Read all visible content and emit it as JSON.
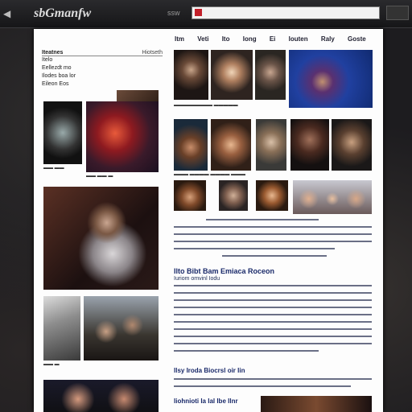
{
  "browser": {
    "logo": "sbGmanfw",
    "menu_label": "ssw"
  },
  "nav": {
    "items": [
      "Itm",
      "Veti",
      "Ito",
      "Iong",
      "Ei",
      "Iouten",
      "Raly",
      "Goste"
    ]
  },
  "sidebar": {
    "header": "Iteatnes",
    "header_right": "Hiotseth",
    "items": [
      "Itelo",
      "Eellezdt mo",
      "Ilodes boa lor",
      "Eileon Eos"
    ]
  },
  "colors": {
    "chrome": "#1b1b1e",
    "page": "#fdfdfd",
    "accent_red": "#c2202a",
    "link_text": "#1a2a6a"
  },
  "article": {
    "headline_1": "Ilto Bibt Bam Emiaca Roceon",
    "subhead_1": "Iuriom omvinl Iodu",
    "headline_2": "Ilsy Iroda Biocrsl oir Iin",
    "headline_3": "Iiohnioti Ia Ial Ibe Ilnr"
  },
  "photos": {
    "left": [
      "crystal-ball",
      "red-costume-figure",
      "dark-scene",
      "wrestler-costume",
      "rocker-portrait",
      "studio-equipment",
      "crowd-faces",
      "man-face",
      "man-face-2"
    ],
    "grid": [
      "man-long-hair",
      "woman-blonde",
      "man-cap",
      "stage-figure",
      "man-hat",
      "woman-smile",
      "man-closeup",
      "man-dark",
      "man-beard",
      "woman-hat",
      "bald-man",
      "woman-red",
      "woman-curly",
      "group-of-women"
    ]
  }
}
